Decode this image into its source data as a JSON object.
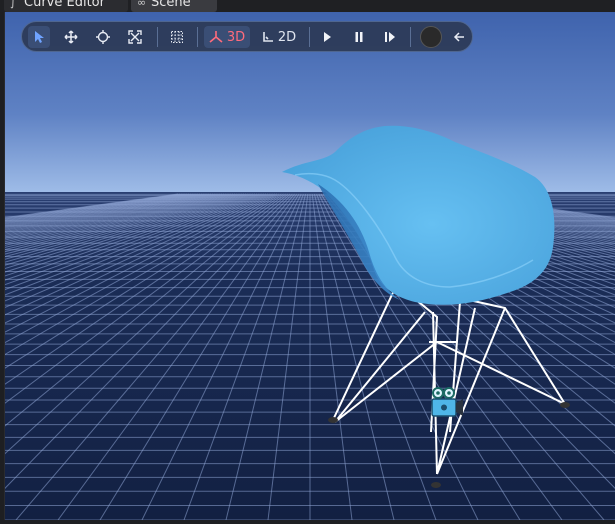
{
  "tabs": [
    {
      "label": "Curve Editor",
      "icon": "curve-icon"
    },
    {
      "label": "Scene",
      "icon": "scene-icon"
    }
  ],
  "toolbar": {
    "tools": [
      {
        "name": "select-tool",
        "icon": "cursor-icon",
        "active": true
      },
      {
        "name": "move-tool",
        "icon": "move-icon",
        "active": false
      },
      {
        "name": "rotate-tool",
        "icon": "rotate-icon",
        "active": false
      },
      {
        "name": "scale-tool",
        "icon": "scale-icon",
        "active": false
      },
      {
        "name": "grid-snap-toggle",
        "icon": "grid-icon",
        "active": false
      }
    ],
    "mode_3d_label": "3D",
    "mode_2d_label": "2D",
    "active_mode": "3D",
    "playback": [
      "play-icon",
      "pause-icon",
      "step-icon"
    ],
    "record_icon": "record-icon",
    "back_icon": "arrow-left-icon"
  },
  "colors": {
    "sky_top": "#3f63ad",
    "horizon": "#9bb8e6",
    "ground": "#152447",
    "grid_line": "#8fa6d6",
    "chair_seat": "#58b3ea",
    "chair_legs": "#ffffff",
    "mode_3d_accent": "#ff6b7c",
    "camera_gizmo": "#4fb6e8"
  }
}
